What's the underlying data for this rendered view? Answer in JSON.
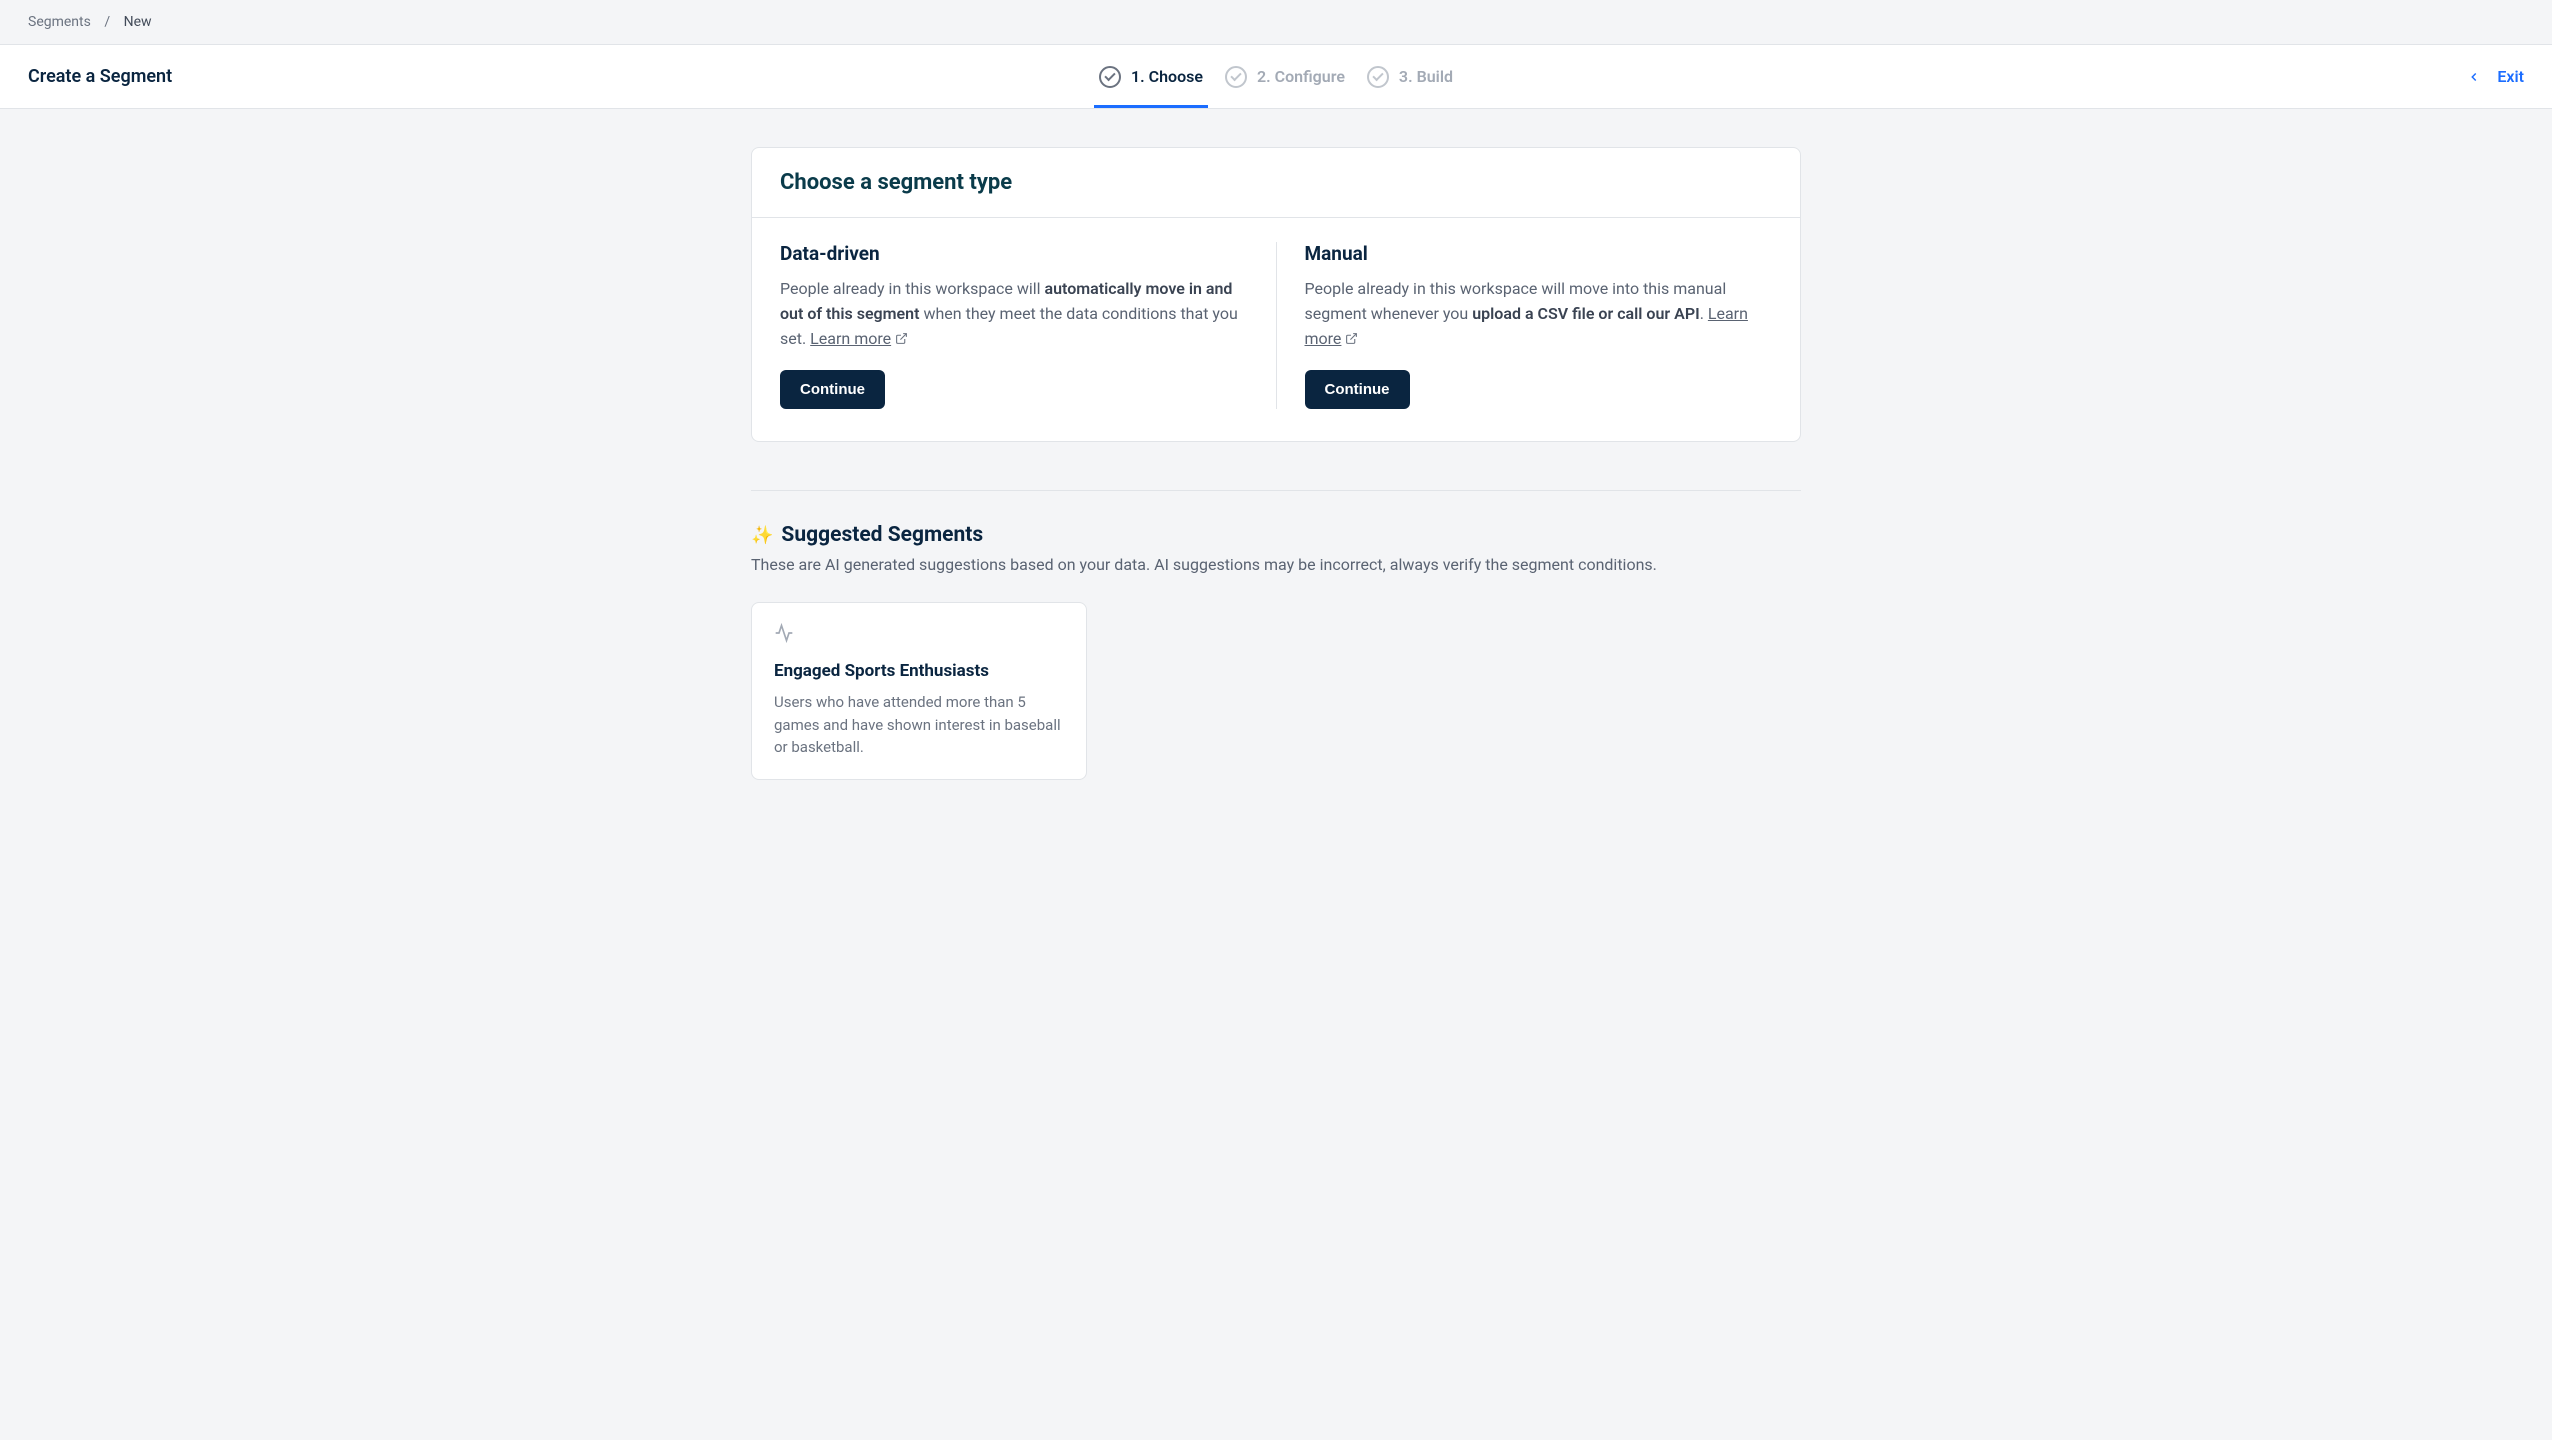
{
  "breadcrumb": {
    "items": [
      "Segments"
    ],
    "current": "New"
  },
  "header": {
    "title": "Create a Segment",
    "steps": [
      {
        "label": "1. Choose",
        "active": true
      },
      {
        "label": "2. Configure",
        "active": false
      },
      {
        "label": "3. Build",
        "active": false
      }
    ],
    "exit_label": "Exit"
  },
  "choose_card": {
    "heading": "Choose a segment type",
    "options": [
      {
        "title": "Data-driven",
        "desc_pre": "People already in this workspace will ",
        "desc_bold": "automatically move in and out of this segment",
        "desc_post": " when they meet the data conditions that you set. ",
        "learn_more": "Learn more",
        "continue": "Continue"
      },
      {
        "title": "Manual",
        "desc_pre": "People already in this workspace will move into this manual segment whenever you ",
        "desc_bold": "upload a CSV file or call our API",
        "desc_post": ". ",
        "learn_more": "Learn more",
        "continue": "Continue"
      }
    ]
  },
  "suggested": {
    "heading": "Suggested Segments",
    "description": "These are AI generated suggestions based on your data. AI suggestions may be incorrect, always verify the segment conditions.",
    "cards": [
      {
        "title": "Engaged Sports Enthusiasts",
        "description": "Users who have attended more than 5 games and have shown interest in baseball or basketball."
      }
    ]
  }
}
